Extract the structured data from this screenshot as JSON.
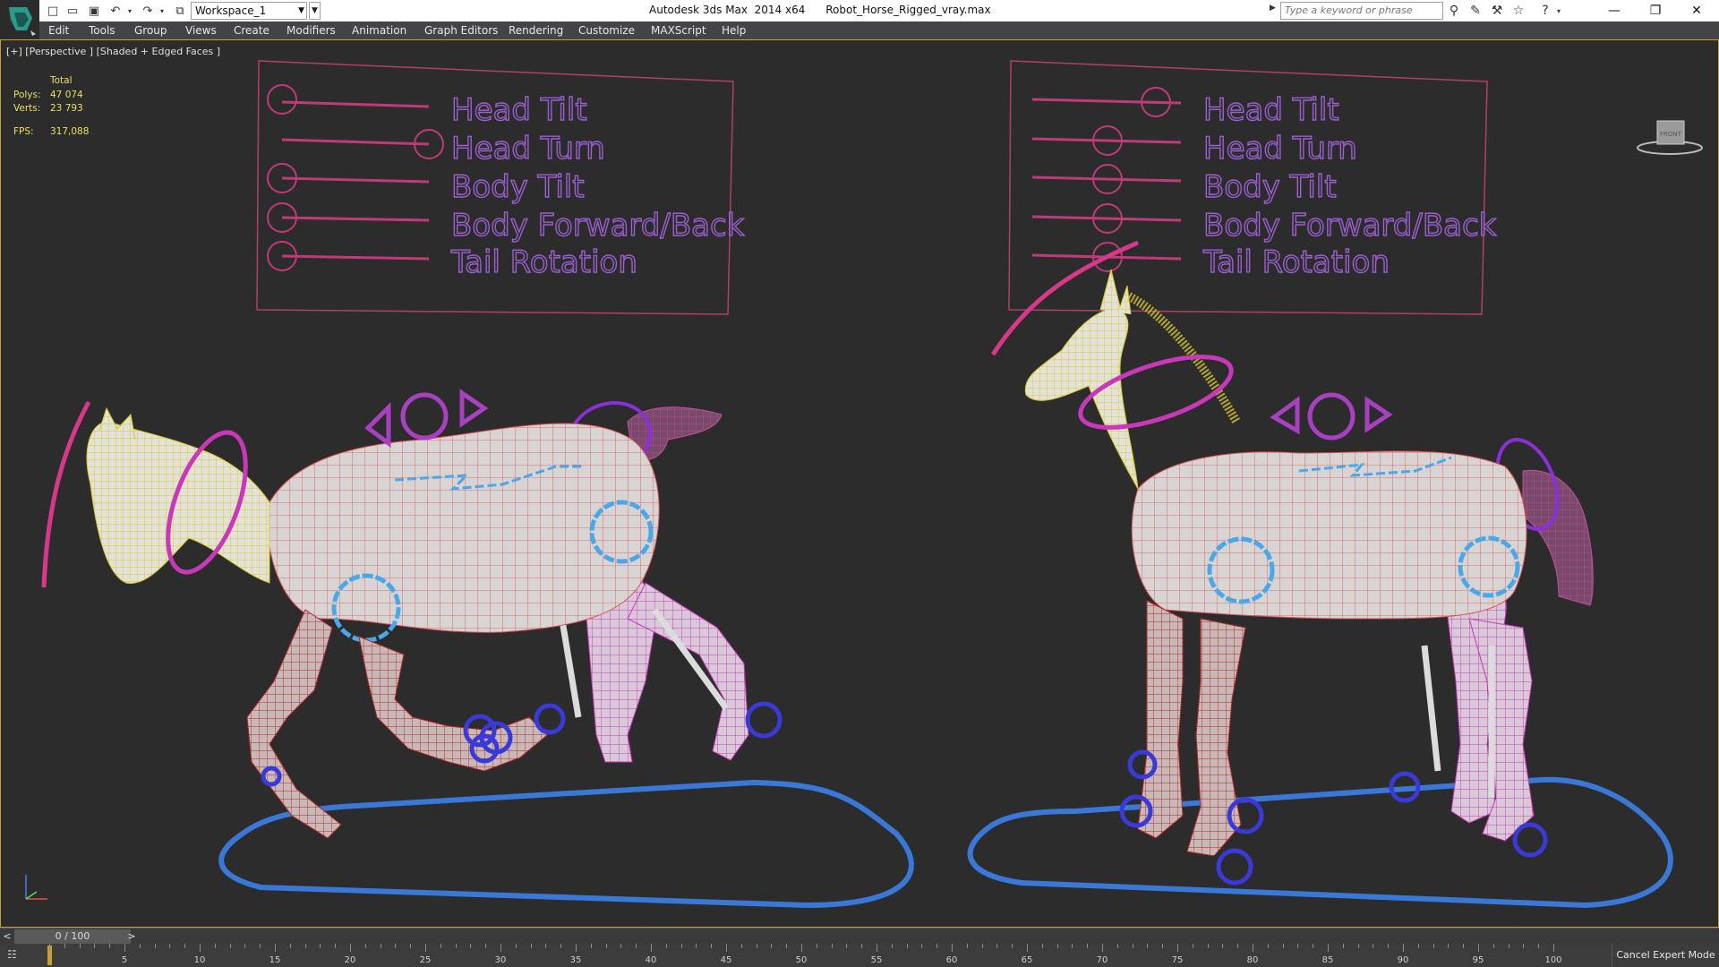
{
  "titlebar": {
    "workspace": "Workspace_1",
    "app_title": "Autodesk 3ds Max  2014 x64",
    "file_name": "Robot_Horse_Rigged_vray.max",
    "search_placeholder": "Type a keyword or phrase"
  },
  "menu": [
    "Edit",
    "Tools",
    "Group",
    "Views",
    "Create",
    "Modifiers",
    "Animation",
    "Graph Editors",
    "Rendering",
    "Customize",
    "MAXScript",
    "Help"
  ],
  "viewport": {
    "label": "[+] [Perspective ] [Shaded + Edged Faces ]",
    "stats": {
      "total_label": "Total",
      "polys_label": "Polys:",
      "polys_value": "47 074",
      "verts_label": "Verts:",
      "verts_value": "23 793",
      "fps_label": "FPS:",
      "fps_value": "317,088"
    },
    "viewcube_label": "FRONT"
  },
  "control_panels": [
    {
      "labels": [
        "Head Tilt",
        "Head Turn",
        "Body Tilt",
        "Body Forward/Back",
        "Tail Rotation"
      ],
      "slider_values": [
        0.0,
        1.0,
        0.0,
        0.0,
        0.0
      ]
    },
    {
      "labels": [
        "Head Tilt",
        "Head Turn",
        "Body Tilt",
        "Body Forward/Back",
        "Tail Rotation"
      ],
      "slider_values": [
        0.82,
        0.5,
        0.5,
        0.5,
        0.5
      ]
    }
  ],
  "timeline": {
    "slider_text": "0 / 100",
    "prev": "<",
    "next": ">",
    "ticks": [
      "5",
      "10",
      "15",
      "20",
      "25",
      "30",
      "35",
      "40",
      "45",
      "50",
      "55",
      "60",
      "65",
      "70",
      "75",
      "80",
      "85",
      "90",
      "95",
      "100"
    ],
    "cancel_expert": "Cancel Expert Mode"
  },
  "colors": {
    "panel_border": "#b04068",
    "slider_color": "#c03a7a",
    "text_outline": "#9a5fd0",
    "wire_yellow": "#e8d84a",
    "wire_red": "#d04040",
    "wire_magenta": "#d050c0",
    "ground_blue": "#3a78d8",
    "ring_magenta": "#d838b0",
    "ring_blue": "#3a3ad8",
    "viewport_border": "#c8a030"
  }
}
